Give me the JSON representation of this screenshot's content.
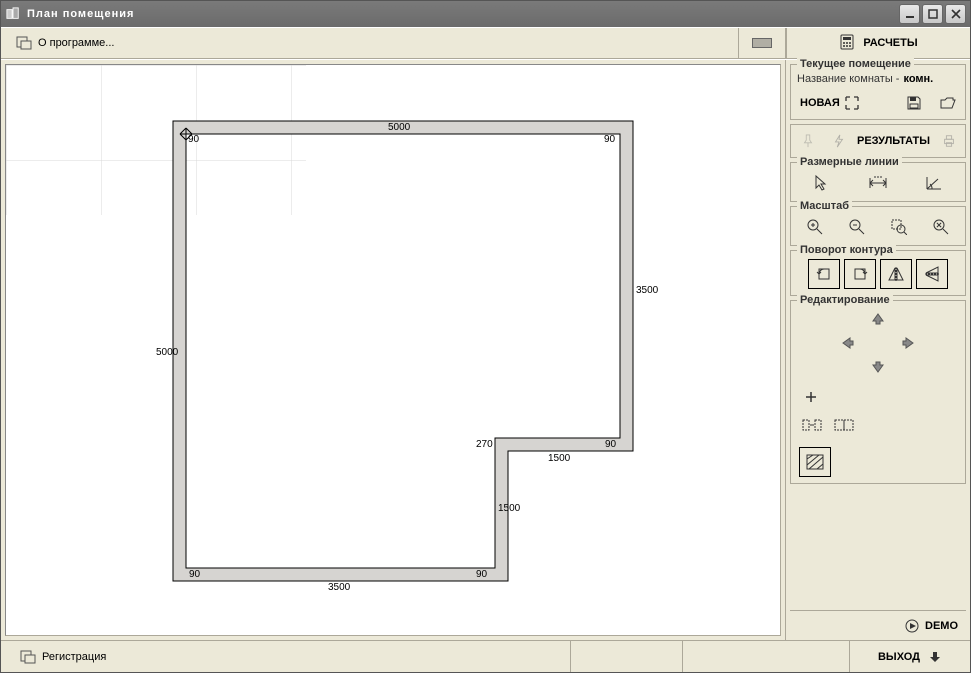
{
  "window": {
    "title": "План помещения"
  },
  "toolbar": {
    "about": "О программе...",
    "calc": "РАСЧЕТЫ"
  },
  "side": {
    "current_room": {
      "legend": "Текущее помещение",
      "name_label": "Название комнаты -",
      "name_value": "комн.",
      "new": "НОВАЯ"
    },
    "results": "РЕЗУЛЬТАТЫ",
    "dim_lines": "Размерные линии",
    "scale": "Масштаб",
    "rotate": "Поворот контура",
    "edit": "Редактирование"
  },
  "footer": {
    "reg": "Регистрация",
    "demo": "DEMO",
    "exit": "ВЫХОД"
  },
  "plan": {
    "dims": {
      "top": "5000",
      "left": "5000",
      "right": "3500",
      "cut_h": "1500",
      "cut_v": "1500",
      "bottom": "3500",
      "notch_angle": "270"
    },
    "angle90": "90"
  }
}
